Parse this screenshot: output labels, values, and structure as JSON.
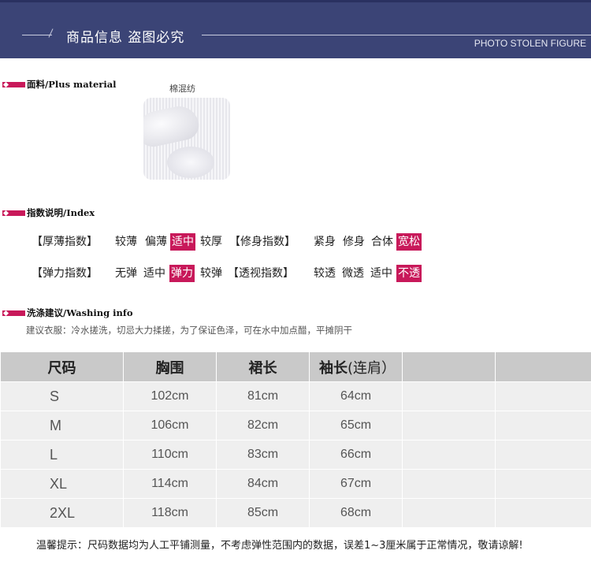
{
  "banner": {
    "title": "商品信息 盗图必究",
    "subtitle": "PHOTO STOLEN FIGURE"
  },
  "fabric": {
    "header": "面料/Plus material",
    "swatch_caption": "棉混纺"
  },
  "index": {
    "header": "指数说明/Index",
    "rows": [
      {
        "left_label": "【厚薄指数】",
        "left_options": [
          "较薄",
          "偏薄",
          "适中",
          "较厚"
        ],
        "left_selected": 2,
        "right_label": "【修身指数】",
        "right_options": [
          "紧身",
          "修身",
          "合体",
          "宽松"
        ],
        "right_selected": 3
      },
      {
        "left_label": "【弹力指数】",
        "left_options": [
          "无弹",
          "适中",
          "弹力",
          "较弹"
        ],
        "left_selected": 2,
        "right_label": "【透视指数】",
        "right_options": [
          "较透",
          "微透",
          "适中",
          "不透"
        ],
        "right_selected": 3
      }
    ]
  },
  "washing": {
    "header": "洗涤建议/Washing info",
    "text": "建议衣服：冷水搓洗，切忌大力揉搓，为了保证色泽，可在水中加点醋，平摊阴干"
  },
  "size_table": {
    "headers": [
      "尺码",
      "胸围",
      "裙长",
      "袖长",
      "(连肩）",
      "",
      ""
    ],
    "rows": [
      [
        "S",
        "102cm",
        "81cm",
        "64cm",
        "",
        ""
      ],
      [
        "M",
        "106cm",
        "82cm",
        "65cm",
        "",
        ""
      ],
      [
        "L",
        "110cm",
        "83cm",
        "66cm",
        "",
        ""
      ],
      [
        "XL",
        "114cm",
        "84cm",
        "67cm",
        "",
        ""
      ],
      [
        "2XL",
        "118cm",
        "85cm",
        "68cm",
        "",
        ""
      ]
    ]
  },
  "note": "温馨提示：尺码数据均为人工平铺测量，不考虑弹性范围内的数据，误差1~3厘米属于正常情况，敬请谅解!",
  "colors": {
    "banner": "#3b4476",
    "accent": "#c8195a",
    "table_header": "#c9c9c9",
    "table_cell": "#efefef"
  }
}
